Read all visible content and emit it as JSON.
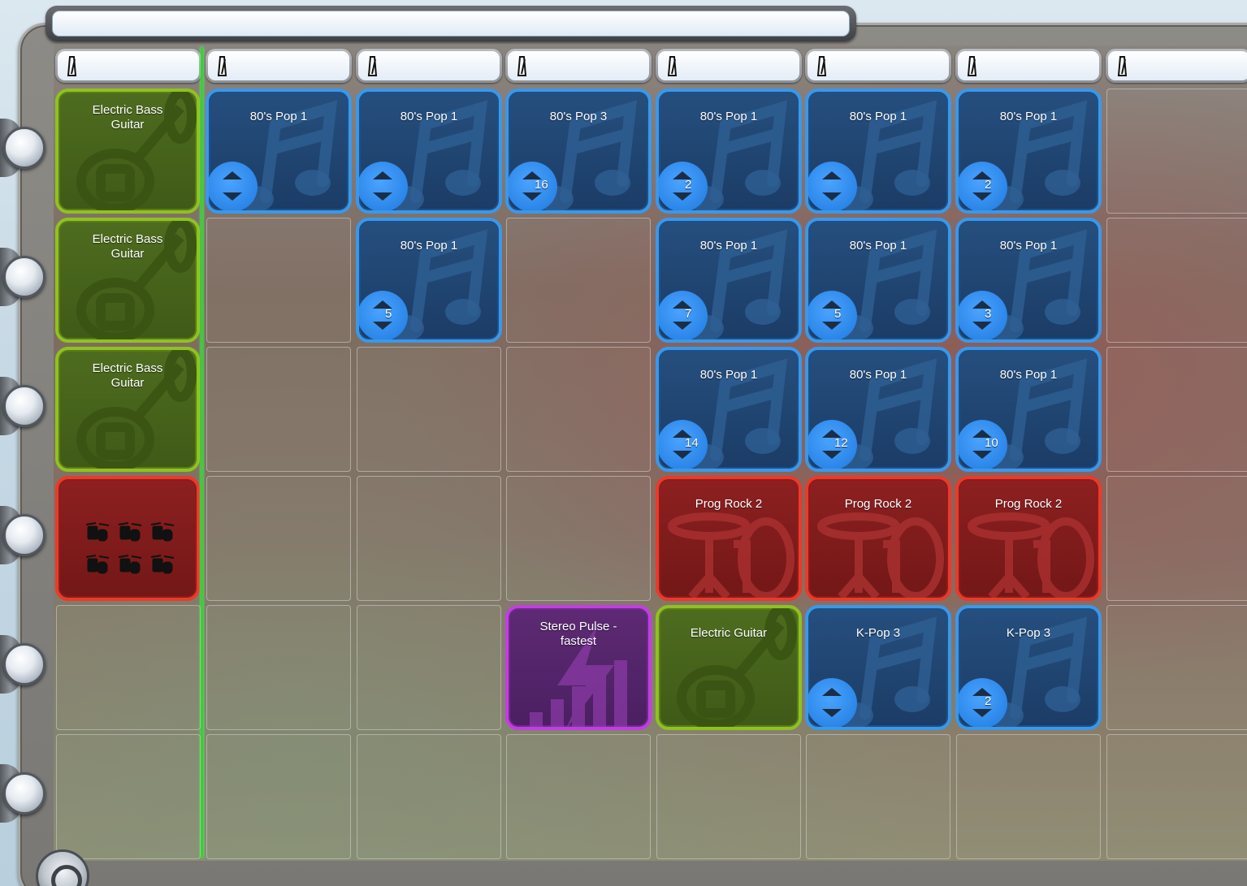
{
  "song_title": "",
  "colors": {
    "loop": "#3a98ea",
    "instrument": "#8fc21e",
    "drums": "#ea3a2a",
    "effect": "#c43ce6",
    "playhead": "#2fd52f"
  },
  "columns": [
    "",
    "",
    "",
    "",
    "",
    "",
    "",
    ""
  ],
  "tracks": [
    {
      "header": {
        "label": "Electric Bass\nGuitar",
        "type": "instrument",
        "icon": "tuba-icon"
      },
      "clips": [
        {
          "col": 1,
          "label": "80's Pop 1",
          "type": "loop",
          "count": ""
        },
        {
          "col": 2,
          "label": "80's Pop 1",
          "type": "loop",
          "count": ""
        },
        {
          "col": 3,
          "label": "80's Pop 3",
          "type": "loop",
          "count": "16"
        },
        {
          "col": 4,
          "label": "80's Pop 1",
          "type": "loop",
          "count": "2"
        },
        {
          "col": 5,
          "label": "80's Pop 1",
          "type": "loop",
          "count": ""
        },
        {
          "col": 6,
          "label": "80's Pop 1",
          "type": "loop",
          "count": "2"
        }
      ]
    },
    {
      "header": {
        "label": "Electric Bass\nGuitar",
        "type": "instrument",
        "icon": "tuba-icon"
      },
      "clips": [
        {
          "col": 2,
          "label": "80's Pop 1",
          "type": "loop",
          "count": "5"
        },
        {
          "col": 4,
          "label": "80's Pop 1",
          "type": "loop",
          "count": "7"
        },
        {
          "col": 5,
          "label": "80's Pop 1",
          "type": "loop",
          "count": "5"
        },
        {
          "col": 6,
          "label": "80's Pop 1",
          "type": "loop",
          "count": "3"
        }
      ]
    },
    {
      "header": {
        "label": "Electric Bass\nGuitar",
        "type": "instrument",
        "icon": "tuba-icon"
      },
      "clips": [
        {
          "col": 4,
          "label": "80's Pop 1",
          "type": "loop",
          "count": "14"
        },
        {
          "col": 5,
          "label": "80's Pop 1",
          "type": "loop",
          "count": "12"
        },
        {
          "col": 6,
          "label": "80's Pop 1",
          "type": "loop",
          "count": "10"
        }
      ]
    },
    {
      "header": {
        "label": "",
        "type": "drums",
        "icon": "drum-kit-icon"
      },
      "clips": [
        {
          "col": 4,
          "label": "Prog Rock 2",
          "type": "drums",
          "count": ""
        },
        {
          "col": 5,
          "label": "Prog Rock 2",
          "type": "drums",
          "count": ""
        },
        {
          "col": 6,
          "label": "Prog Rock 2",
          "type": "drums",
          "count": ""
        }
      ]
    },
    {
      "header": null,
      "clips": [
        {
          "col": 3,
          "label": "Stereo Pulse -\nfastest",
          "type": "effect",
          "count": ""
        },
        {
          "col": 4,
          "label": "Electric Guitar",
          "type": "instrument",
          "count": ""
        },
        {
          "col": 5,
          "label": "K-Pop 3",
          "type": "loop",
          "count": ""
        },
        {
          "col": 6,
          "label": "K-Pop 3",
          "type": "loop",
          "count": "2"
        }
      ]
    },
    {
      "header": null,
      "clips": []
    }
  ]
}
